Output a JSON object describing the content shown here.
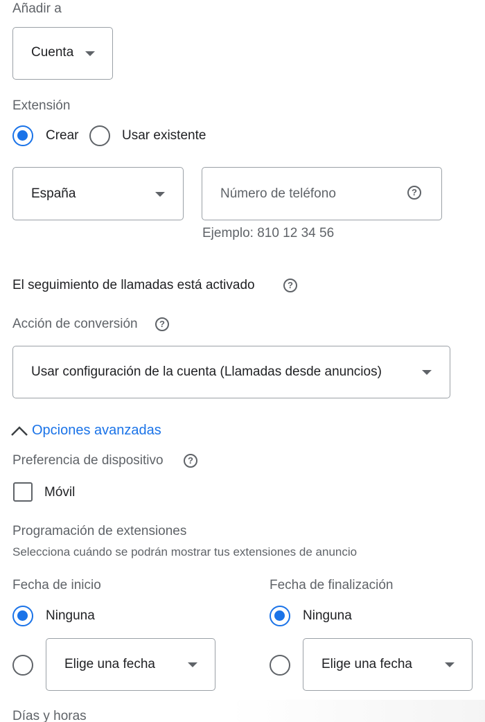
{
  "add_to": {
    "label": "Añadir a",
    "select_value": "Cuenta"
  },
  "extension": {
    "label": "Extensión",
    "radio_create": "Crear",
    "radio_existing": "Usar existente",
    "selected": "Crear"
  },
  "phone": {
    "country_value": "España",
    "number_placeholder": "Número de teléfono",
    "example": "Ejemplo: 810 12 34 56"
  },
  "call_tracking": {
    "text": "El seguimiento de llamadas está activado"
  },
  "conversion": {
    "label": "Acción de conversión",
    "select_value": "Usar configuración de la cuenta (Llamadas desde anuncios)"
  },
  "advanced": {
    "toggle_label": "Opciones avanzadas",
    "device_label": "Preferencia de dispositivo",
    "mobile_label": "Móvil",
    "mobile_checked": false
  },
  "schedule": {
    "title": "Programación de extensiones",
    "subtitle": "Selecciona cuándo se podrán mostrar tus extensiones de anuncio",
    "start": {
      "label": "Fecha de inicio",
      "none_label": "Ninguna",
      "date_placeholder": "Elige una fecha",
      "selected": "Ninguna"
    },
    "end": {
      "label": "Fecha de finalización",
      "none_label": "Ninguna",
      "date_placeholder": "Elige una fecha",
      "selected": "Ninguna"
    },
    "days_hours_label": "Días y horas"
  },
  "colors": {
    "accent": "#1a73e8",
    "text": "#202124",
    "muted": "#5f6368",
    "border": "#9aa0a6"
  },
  "icons": {
    "dropdown": "caret-down-icon",
    "help": "help-circle-icon",
    "collapse": "chevron-up-icon"
  }
}
